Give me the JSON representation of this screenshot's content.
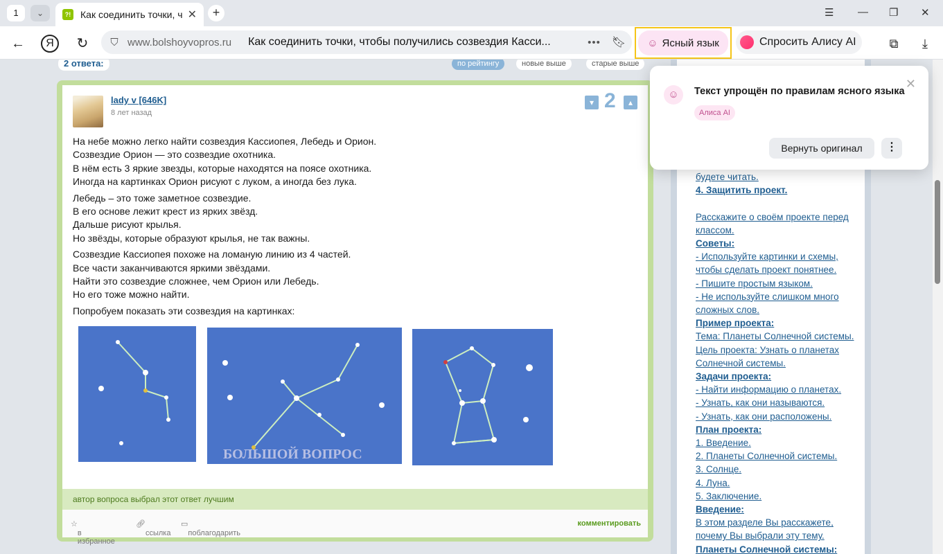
{
  "browser": {
    "tab_count": "1",
    "tab_title": "Как соединить точки, ч",
    "favicon_text": "?!",
    "url_domain": "www.bolshoyvopros.ru",
    "page_title": "Как соединить точки, чтобы получились созвездия Касси...",
    "clear_lang_label": "Ясный язык",
    "alice_label": "Спросить Алису AI",
    "icons": [
      "back-icon",
      "yandex-icon",
      "reload-icon",
      "shield-icon",
      "more-icon",
      "bookmark-icon",
      "collections-icon",
      "download-icon"
    ]
  },
  "answers": {
    "count_label": "2 ответа:",
    "sort": [
      "по рейтингу",
      "новые выше",
      "старые выше"
    ]
  },
  "answer": {
    "user": "lady v [646K]",
    "date": "8 лет назад",
    "votes": "2",
    "paragraphs": [
      [
        "На небе можно легко найти созвездия Кассиопея, Лебедь и Орион.",
        "Созвездие Орион — это созвездие охотника.",
        "В нём есть 3 яркие звезды, которые находятся на поясе охотника.",
        "Иногда на картинках Орион рисуют с луком, а иногда без лука."
      ],
      [
        "Лебедь – это тоже заметное созвездие.",
        "В его основе лежит крест из ярких звёзд.",
        "Дальше рисуют крылья.",
        "Но звёзды, которые образуют крылья, не так важны."
      ],
      [
        "Созвездие Кассиопея похоже на ломаную линию из 4 частей.",
        "Все части заканчиваются яркими звёздами.",
        "Найти это созвездие сложнее, чем Орион или Лебедь.",
        "Но его тоже можно найти."
      ],
      [
        "Попробуем показать эти созвездия на картинках:"
      ]
    ],
    "watermark": "БОЛЬШОЙ ВОПРОС",
    "chosen_text": "автор вопроса выбрал этот ответ лучшим",
    "actions": [
      "в избранное",
      "ссылка",
      "поблагодарить"
    ],
    "comment": "комментировать"
  },
  "sidebar": {
    "lines": [
      {
        "t": "будете читать.",
        "b": false
      },
      {
        "t": "4. Защитить проект.",
        "b": true
      },
      {
        "t": "",
        "b": false
      },
      {
        "t": "Расскажите о своём проекте перед",
        "b": false
      },
      {
        "t": "классом.",
        "b": false
      },
      {
        "t": "Советы:",
        "b": true
      },
      {
        "t": "- Используйте картинки и схемы,",
        "b": false
      },
      {
        "t": "чтобы сделать проект понятнее.",
        "b": false
      },
      {
        "t": "- Пишите простым языком.",
        "b": false
      },
      {
        "t": "- Не используйте слишком много",
        "b": false
      },
      {
        "t": "сложных слов.",
        "b": false
      },
      {
        "t": "Пример проекта:",
        "b": true
      },
      {
        "t": "Тема: Планеты Солнечной системы.",
        "b": false
      },
      {
        "t": "Цель проекта: Узнать о планетах",
        "b": false
      },
      {
        "t": "Солнечной системы.",
        "b": false
      },
      {
        "t": "Задачи проекта:",
        "b": true
      },
      {
        "t": "- Найти информацию о планетах.",
        "b": false
      },
      {
        "t": "- Узнать, как они называются.",
        "b": false
      },
      {
        "t": "- Узнать, как они расположены.",
        "b": false
      },
      {
        "t": "План проекта:",
        "b": true
      },
      {
        "t": "1. Введение.",
        "b": false
      },
      {
        "t": "2. Планеты Солнечной системы.",
        "b": false
      },
      {
        "t": "3. Солнце.",
        "b": false
      },
      {
        "t": "4. Луна.",
        "b": false
      },
      {
        "t": "5. Заключение.",
        "b": false
      },
      {
        "t": "Введение:",
        "b": true
      },
      {
        "t": "В этом разделе Вы расскажете,",
        "b": false
      },
      {
        "t": "почему Вы выбрали эту тему.",
        "b": false
      },
      {
        "t": "Планеты Солнечной системы:",
        "b": true
      }
    ]
  },
  "popup": {
    "text": "Текст упрощён по правилам ясного языка",
    "tag": "Алиса AI",
    "revert": "Вернуть оригинал"
  }
}
